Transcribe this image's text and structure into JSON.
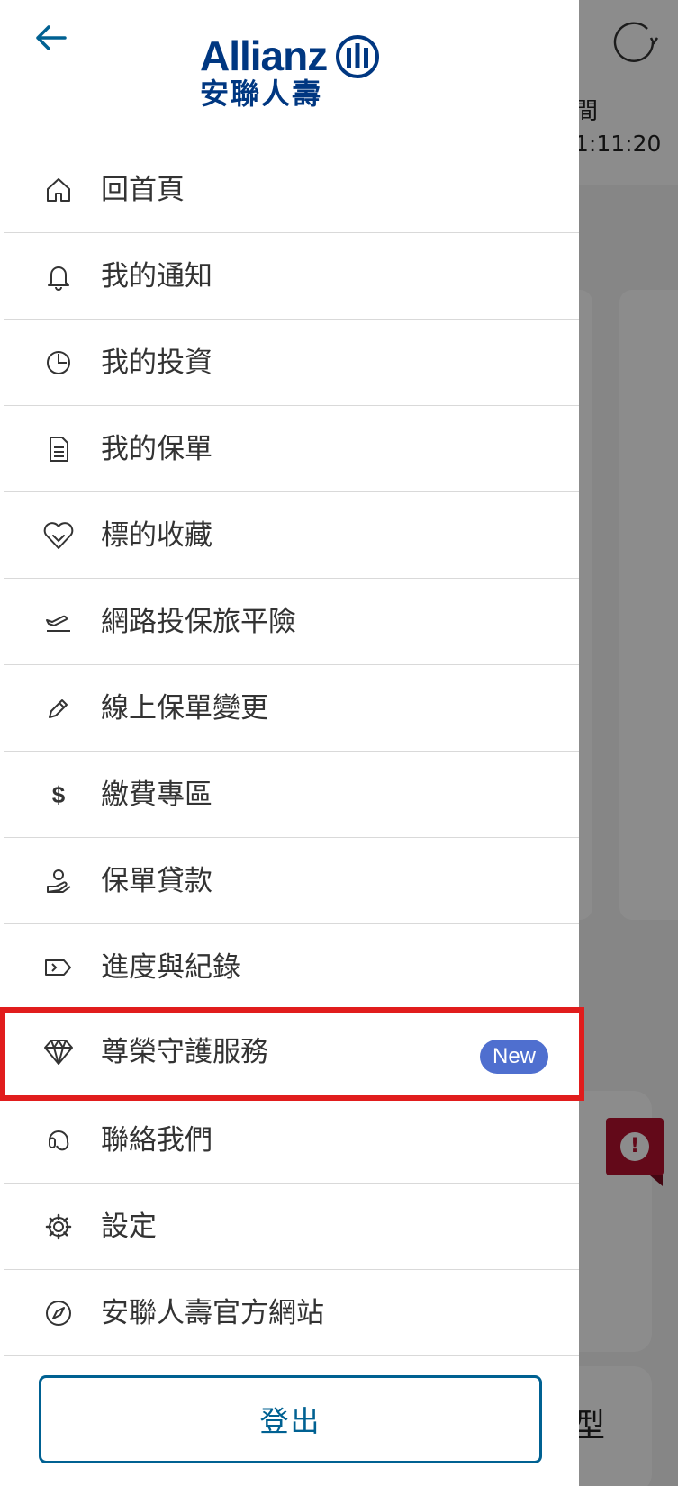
{
  "background": {
    "text_1": "間",
    "text_2": "1:11:20",
    "text_3": "型",
    "alert_mark": "!"
  },
  "drawer": {
    "logo_brand": "Allianz",
    "logo_cn": "安聯人壽",
    "menu": [
      {
        "label": "回首頁",
        "icon": "home-icon"
      },
      {
        "label": "我的通知",
        "icon": "bell-icon"
      },
      {
        "label": "我的投資",
        "icon": "pie-chart-icon"
      },
      {
        "label": "我的保單",
        "icon": "document-icon"
      },
      {
        "label": "標的收藏",
        "icon": "heart-icon"
      },
      {
        "label": "網路投保旅平險",
        "icon": "plane-icon"
      },
      {
        "label": "線上保單變更",
        "icon": "pencil-icon"
      },
      {
        "label": "繳費專區",
        "icon": "dollar-icon",
        "glyph": "$"
      },
      {
        "label": "保單貸款",
        "icon": "loan-hand-icon"
      },
      {
        "label": "進度與紀錄",
        "icon": "tag-icon"
      },
      {
        "label": "尊榮守護服務",
        "icon": "diamond-icon",
        "badge": "New"
      },
      {
        "label": "聯絡我們",
        "icon": "headset-icon"
      },
      {
        "label": "設定",
        "icon": "gear-icon"
      },
      {
        "label": "安聯人壽官方網站",
        "icon": "compass-icon"
      }
    ],
    "logout_label": "登出"
  },
  "colors": {
    "brand": "#003781",
    "accent": "#006192",
    "highlight_border": "#e11d1d",
    "badge": "#4f6fcf"
  }
}
